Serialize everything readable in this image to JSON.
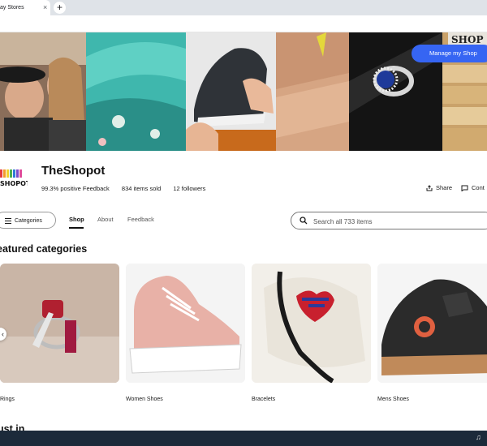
{
  "browser": {
    "tab_title": "ay Stores",
    "tab_close": "×",
    "new_tab": "+"
  },
  "banner": {
    "manage_button": "Manage my Shop",
    "shop_sign": "SHOP"
  },
  "shop": {
    "name": "TheShopot",
    "logo_text": "SHOPOT",
    "feedback": "99.3% positive Feedback",
    "items_sold": "834 items sold",
    "followers": "12 followers",
    "share_label": "Share",
    "contact_label": "Cont"
  },
  "nav": {
    "categories_button": "Categories",
    "tabs": [
      "Shop",
      "About",
      "Feedback"
    ],
    "active_tab": "Shop",
    "search_placeholder": "Search all 733 items"
  },
  "featured": {
    "title": "eatured categories",
    "items": [
      {
        "label": "Rings"
      },
      {
        "label": "Women Shoes"
      },
      {
        "label": "Bracelets"
      },
      {
        "label": "Mens Shoes"
      }
    ]
  },
  "just_in": {
    "title": "ust in"
  },
  "colors": {
    "accent": "#3665f3",
    "taskbar": "#1c2a3a"
  }
}
